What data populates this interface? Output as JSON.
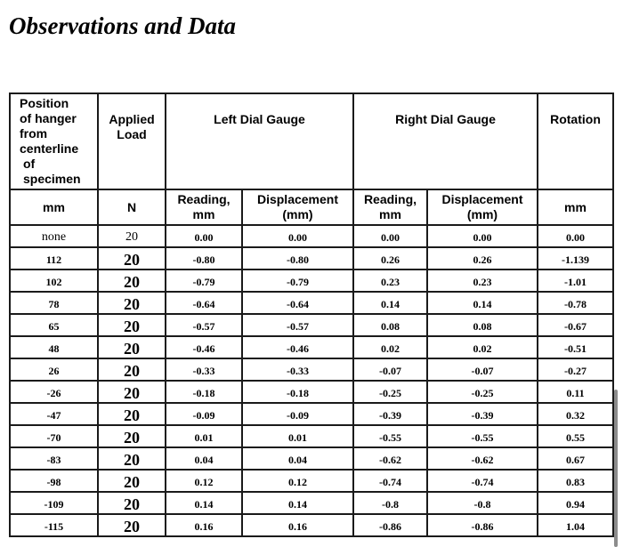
{
  "title": "Observations and Data",
  "table": {
    "header_row1": {
      "position": [
        "Position",
        "of hanger",
        "from",
        "centerline",
        " of",
        " specimen"
      ],
      "applied_load": [
        "Applied",
        "Load"
      ],
      "left_gauge": "Left Dial Gauge",
      "right_gauge": "Right Dial Gauge",
      "rotation": "Rotation"
    },
    "header_row2": {
      "position_unit": "mm",
      "load_unit": "N",
      "left_reading": [
        "Reading,",
        "mm"
      ],
      "left_displacement": [
        "Displacement",
        "(mm)"
      ],
      "right_reading": [
        "Reading,",
        "mm"
      ],
      "right_displacement": [
        "Displacement",
        "(mm)"
      ],
      "rotation_unit": "mm"
    },
    "rows": [
      {
        "position": "none",
        "load": "20",
        "left_reading": "0.00",
        "left_displacement": "0.00",
        "right_reading": "0.00",
        "right_displacement": "0.00",
        "rotation": "0.00"
      },
      {
        "position": "112",
        "load": "20",
        "left_reading": "-0.80",
        "left_displacement": "-0.80",
        "right_reading": "0.26",
        "right_displacement": "0.26",
        "rotation": "-1.139"
      },
      {
        "position": "102",
        "load": "20",
        "left_reading": "-0.79",
        "left_displacement": "-0.79",
        "right_reading": "0.23",
        "right_displacement": "0.23",
        "rotation": "-1.01"
      },
      {
        "position": "78",
        "load": "20",
        "left_reading": "-0.64",
        "left_displacement": "-0.64",
        "right_reading": "0.14",
        "right_displacement": "0.14",
        "rotation": "-0.78"
      },
      {
        "position": "65",
        "load": "20",
        "left_reading": "-0.57",
        "left_displacement": "-0.57",
        "right_reading": "0.08",
        "right_displacement": "0.08",
        "rotation": "-0.67"
      },
      {
        "position": "48",
        "load": "20",
        "left_reading": "-0.46",
        "left_displacement": "-0.46",
        "right_reading": "0.02",
        "right_displacement": "0.02",
        "rotation": "-0.51"
      },
      {
        "position": "26",
        "load": "20",
        "left_reading": "-0.33",
        "left_displacement": "-0.33",
        "right_reading": "-0.07",
        "right_displacement": "-0.07",
        "rotation": "-0.27"
      },
      {
        "position": "-26",
        "load": "20",
        "left_reading": "-0.18",
        "left_displacement": "-0.18",
        "right_reading": "-0.25",
        "right_displacement": "-0.25",
        "rotation": "0.11"
      },
      {
        "position": "-47",
        "load": "20",
        "left_reading": "-0.09",
        "left_displacement": "-0.09",
        "right_reading": "-0.39",
        "right_displacement": "-0.39",
        "rotation": "0.32"
      },
      {
        "position": "-70",
        "load": "20",
        "left_reading": "0.01",
        "left_displacement": "0.01",
        "right_reading": "-0.55",
        "right_displacement": "-0.55",
        "rotation": "0.55"
      },
      {
        "position": "-83",
        "load": "20",
        "left_reading": "0.04",
        "left_displacement": "0.04",
        "right_reading": "-0.62",
        "right_displacement": "-0.62",
        "rotation": "0.67"
      },
      {
        "position": "-98",
        "load": "20",
        "left_reading": "0.12",
        "left_displacement": "0.12",
        "right_reading": "-0.74",
        "right_displacement": "-0.74",
        "rotation": "0.83"
      },
      {
        "position": "-109",
        "load": "20",
        "left_reading": "0.14",
        "left_displacement": "0.14",
        "right_reading": "-0.8",
        "right_displacement": "-0.8",
        "rotation": "0.94"
      },
      {
        "position": "-115",
        "load": "20",
        "left_reading": "0.16",
        "left_displacement": "0.16",
        "right_reading": "-0.86",
        "right_displacement": "-0.86",
        "rotation": "1.04"
      }
    ]
  }
}
